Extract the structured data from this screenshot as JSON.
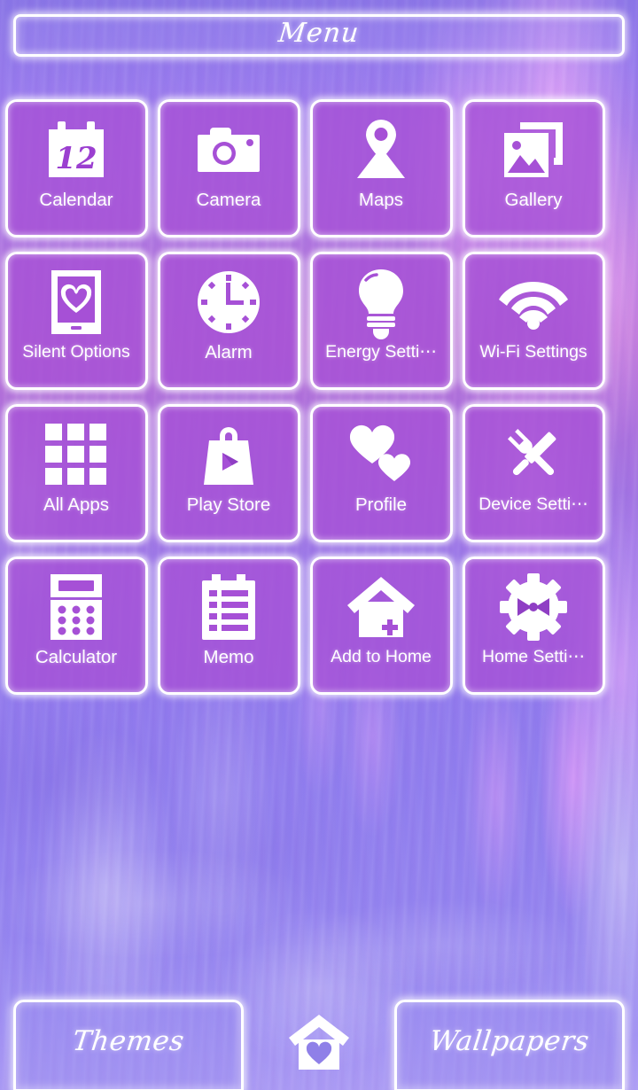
{
  "header": {
    "title": "Menu"
  },
  "theme": {
    "tile_fill": "#a650d6",
    "tile_border": "#ffffff",
    "label_color": "#ffffff",
    "glow_color": "#ffffff",
    "background_kind": "purple-marble-fluid-art"
  },
  "grid": {
    "columns": 4,
    "rows": 4,
    "apps": [
      {
        "label": "Calendar",
        "icon": "calendar-icon",
        "badge": "12"
      },
      {
        "label": "Camera",
        "icon": "camera-icon"
      },
      {
        "label": "Maps",
        "icon": "map-pin-icon"
      },
      {
        "label": "Gallery",
        "icon": "gallery-icon"
      },
      {
        "label": "Silent Options",
        "icon": "phone-heart-icon"
      },
      {
        "label": "Alarm",
        "icon": "clock-icon"
      },
      {
        "label": "Energy Setti⋯",
        "icon": "lightbulb-icon"
      },
      {
        "label": "Wi-Fi Settings",
        "icon": "wifi-icon"
      },
      {
        "label": "All Apps",
        "icon": "grid-apps-icon"
      },
      {
        "label": "Play Store",
        "icon": "play-store-bag-icon"
      },
      {
        "label": "Profile",
        "icon": "two-hearts-icon"
      },
      {
        "label": "Device Setti⋯",
        "icon": "crossed-tools-icon"
      },
      {
        "label": "Calculator",
        "icon": "calculator-icon"
      },
      {
        "label": "Memo",
        "icon": "memo-clipboard-icon"
      },
      {
        "label": "Add to Home",
        "icon": "house-plus-icon"
      },
      {
        "label": "Home Setti⋯",
        "icon": "gear-ribbon-icon"
      }
    ]
  },
  "bottom_bar": {
    "themes_label": "Themes",
    "home_icon": "house-heart-icon",
    "wallpapers_label": "Wallpapers"
  }
}
